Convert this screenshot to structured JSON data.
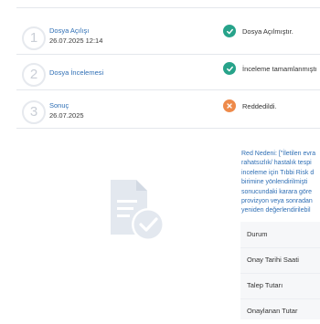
{
  "steps": [
    {
      "number": "1",
      "title": "Dosya Açılışı",
      "date": "26.07.2025 12:14",
      "status_text": "Dosya Açılmıştır.",
      "status": "success"
    },
    {
      "number": "2",
      "title": "Dosya İncelemesi",
      "date": "",
      "status_text": "İnceleme tamamlanmıştı",
      "status": "success"
    },
    {
      "number": "3",
      "title": "Sonuç",
      "date": "26.07.2025",
      "status_text": "Reddedildi.",
      "status": "rejected"
    }
  ],
  "reason_lines": [
    "Red Nedeni: [\"İletilen evra",
    "rahatsızlık/ hastalık tespi",
    "inceleme için Tıbbi Risk d",
    "birimine yönlendirilmişti",
    "sonucundaki karara göre",
    "provizyon veya sonradan",
    "yeniden değerlendirilebil"
  ],
  "details_table": {
    "rows": [
      "Durum",
      "Onay Tarihi Saati",
      "Talep Tutarı",
      "Onaylanan Tutar"
    ]
  },
  "colors": {
    "success": "#27a38a",
    "rejected": "#ee8a4a",
    "link_blue": "#2f6fb5",
    "illustration": "#e3e8ef"
  }
}
